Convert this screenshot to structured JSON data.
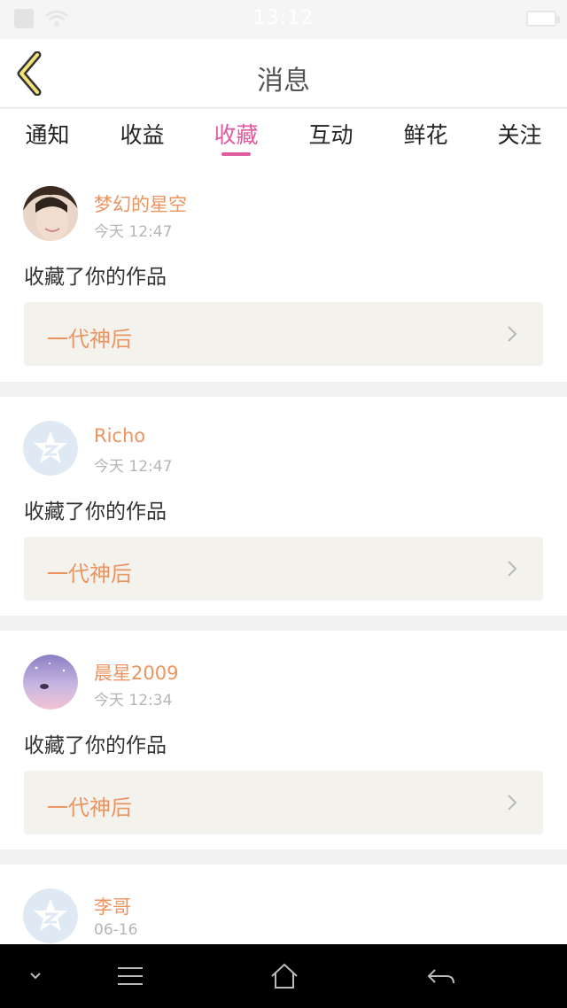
{
  "status_bar": {
    "time": "13:12"
  },
  "header": {
    "title": "消息",
    "back_icon": "chevron-left-icon"
  },
  "tabs": [
    {
      "label": "通知",
      "active": false
    },
    {
      "label": "收益",
      "active": false
    },
    {
      "label": "收藏",
      "active": true
    },
    {
      "label": "互动",
      "active": false
    },
    {
      "label": "鲜花",
      "active": false
    },
    {
      "label": "关注",
      "active": false
    }
  ],
  "messages": [
    {
      "user": "梦幻的星空",
      "time": "今天 12:47",
      "action": "收藏了你的作品",
      "work": "一代神后",
      "avatar": "photo"
    },
    {
      "user": "Richo",
      "time": "今天 12:47",
      "action": "收藏了你的作品",
      "work": "一代神后",
      "avatar": "default"
    },
    {
      "user": "晨星2009",
      "time": "今天 12:34",
      "action": "收藏了你的作品",
      "work": "一代神后",
      "avatar": "pink-sky"
    },
    {
      "user": "李哥",
      "time": "06-16",
      "action": "",
      "work": "",
      "avatar": "default"
    }
  ],
  "colors": {
    "accent": "#e05aa0",
    "name": "#ec9460",
    "work_bg": "#f3f2ec"
  },
  "nav_bar": {
    "icons": [
      "chevron-down-icon",
      "menu-icon",
      "home-icon",
      "back-arrow-icon"
    ]
  }
}
